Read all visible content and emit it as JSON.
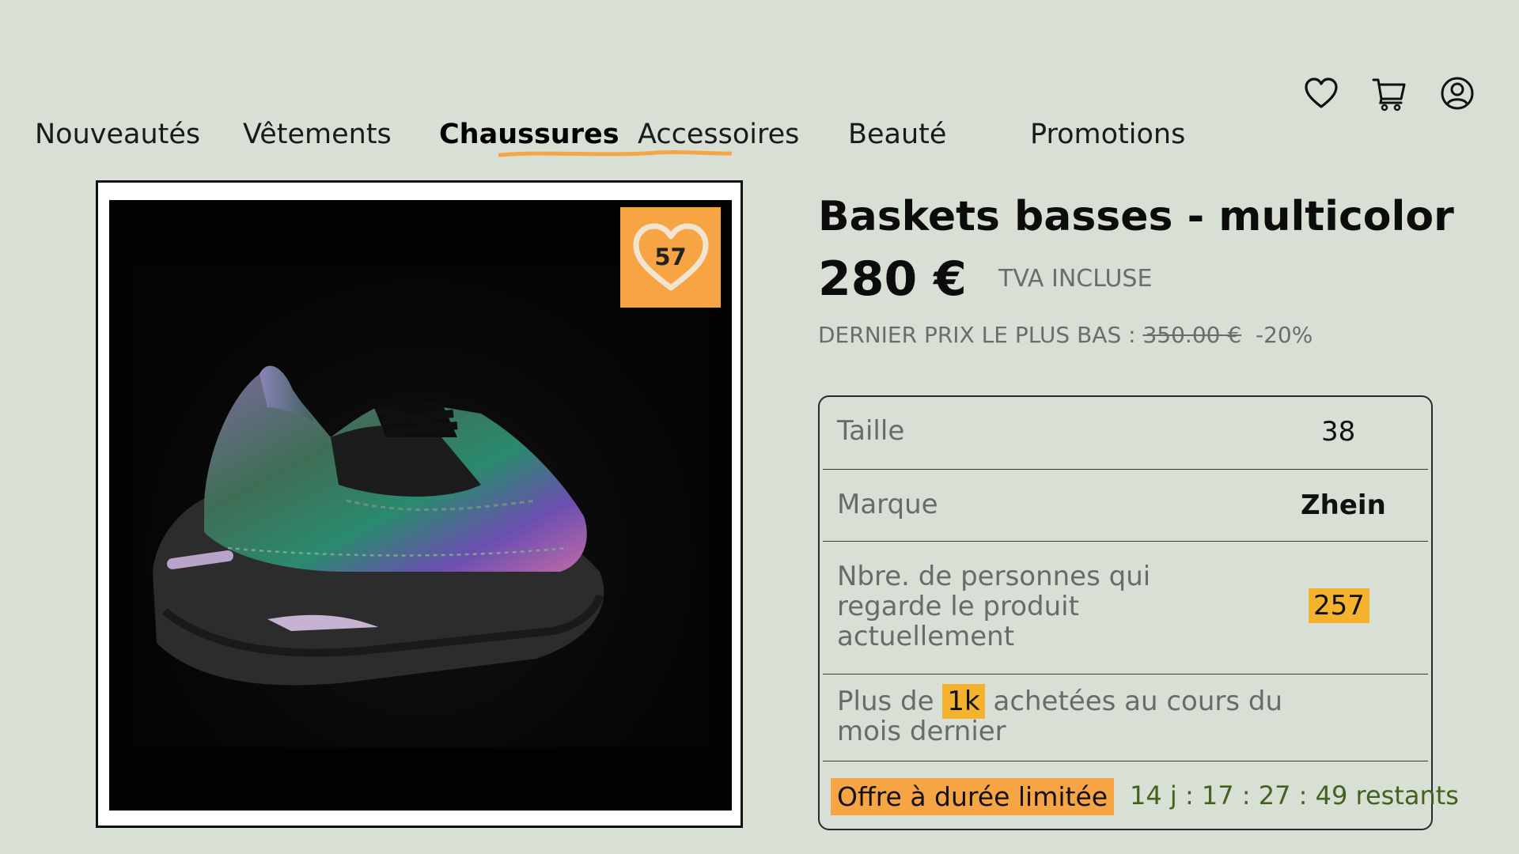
{
  "header": {
    "icons": [
      "heart-icon",
      "cart-icon",
      "user-icon"
    ]
  },
  "nav": {
    "items": [
      {
        "label": "Nouveautés",
        "active": false
      },
      {
        "label": "Vêtements",
        "active": false
      },
      {
        "label": "Chaussures",
        "active": true
      },
      {
        "label": "Accessoires",
        "active": false
      },
      {
        "label": "Beauté",
        "active": false
      },
      {
        "label": "Promotions",
        "active": false
      }
    ],
    "underline_color": "#f7a444"
  },
  "product": {
    "likes": "57",
    "title": "Baskets basses - multicolor",
    "price": "280 €",
    "vat": "TVA INCLUSE",
    "lowest_label": "DERNIER PRIX LE PLUS BAS :",
    "lowest_price": "350.00 €",
    "discount": "-20%"
  },
  "specs": {
    "size_label": "Taille",
    "size_value": "38",
    "brand_label": "Marque",
    "brand_value": "Zhein",
    "viewers_label": "Nbre. de personnes qui regarde le produit actuellement",
    "viewers_value": "257",
    "bought_prefix": "Plus de",
    "bought_value": "1k",
    "bought_suffix": "achetées au cours du mois dernier",
    "offer_label": "Offre à durée limitée",
    "timer": "14 j :  17 : 27 : 49 restants"
  },
  "colors": {
    "background": "#d8e0d5",
    "accent": "#f7a444",
    "highlight": "#f5b32d",
    "timer": "#44611f"
  }
}
